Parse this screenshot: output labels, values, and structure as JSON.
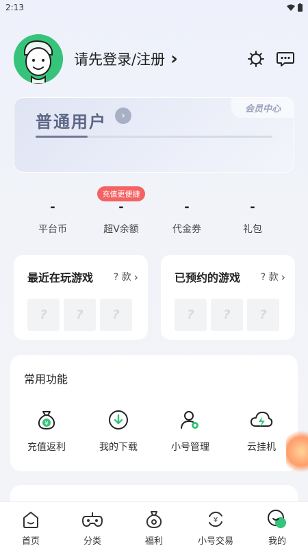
{
  "status": {
    "time": "2:13"
  },
  "header": {
    "login_prompt": "请先登录/注册",
    "login_chevron": "›"
  },
  "member": {
    "level": "普通用户",
    "center_label": "会员中心",
    "progress": 0.22
  },
  "stats": {
    "badge": "充值更便捷",
    "items": [
      {
        "value": "-",
        "label": "平台币"
      },
      {
        "value": "-",
        "label": "超V余额"
      },
      {
        "value": "-",
        "label": "代金券"
      },
      {
        "value": "-",
        "label": "礼包"
      }
    ]
  },
  "games": {
    "recent": {
      "title": "最近在玩游戏",
      "count": "? 款",
      "tiles": [
        "?",
        "?",
        "?"
      ]
    },
    "reserved": {
      "title": "已预约的游戏",
      "count": "? 款",
      "tiles": [
        "?",
        "?",
        "?"
      ]
    }
  },
  "functions": {
    "title": "常用功能",
    "items": [
      {
        "label": "充值返利",
        "icon": "money-bag-icon"
      },
      {
        "label": "我的下载",
        "icon": "download-icon"
      },
      {
        "label": "小号管理",
        "icon": "account-manage-icon"
      },
      {
        "label": "云挂机",
        "icon": "cloud-icon"
      }
    ]
  },
  "tabbar": {
    "items": [
      {
        "label": "首页",
        "icon": "home-icon"
      },
      {
        "label": "分类",
        "icon": "gamepad-icon"
      },
      {
        "label": "福利",
        "icon": "gift-bag-icon"
      },
      {
        "label": "小号交易",
        "icon": "exchange-icon"
      },
      {
        "label": "我的",
        "icon": "profile-icon",
        "active": true
      }
    ]
  },
  "colors": {
    "brand_green": "#36c47a",
    "badge_red": "#f46262"
  }
}
